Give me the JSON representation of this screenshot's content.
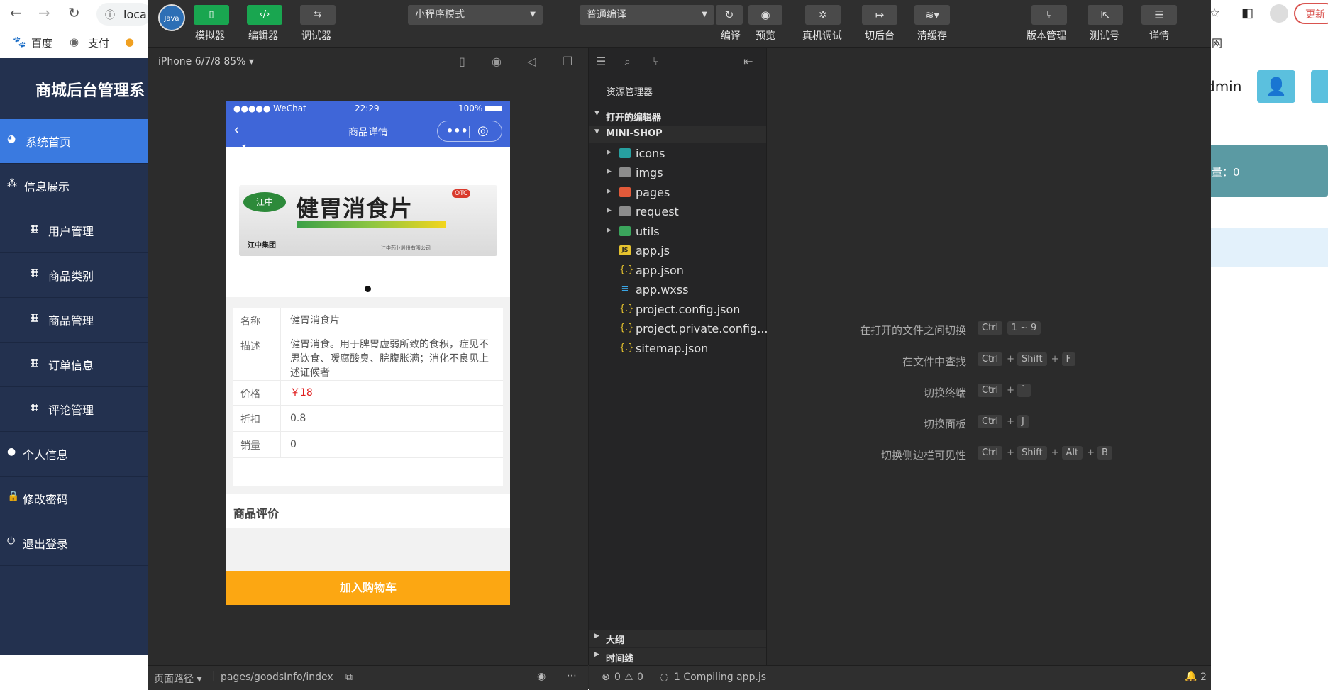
{
  "browser": {
    "address_partial": "loca",
    "bookmarks": [
      "百度",
      "支付"
    ],
    "bookmark_tail": "网",
    "update_label": "更新"
  },
  "admin": {
    "title": "商城后台管理系",
    "user_partial": "dmin",
    "menu": [
      {
        "label": "系统首页",
        "icon": "dashboard-icon",
        "active": true
      },
      {
        "label": "信息展示",
        "icon": "network-icon",
        "active": false
      },
      {
        "label": "用户管理",
        "icon": "grid-icon",
        "active": false
      },
      {
        "label": "商品类别",
        "icon": "grid-icon",
        "active": false
      },
      {
        "label": "商品管理",
        "icon": "grid-icon",
        "active": false
      },
      {
        "label": "订单信息",
        "icon": "grid-icon",
        "active": false
      },
      {
        "label": "评论管理",
        "icon": "grid-icon",
        "active": false
      },
      {
        "label": "个人信息",
        "icon": "user-icon",
        "active": false
      },
      {
        "label": "修改密码",
        "icon": "lock-icon",
        "active": false
      },
      {
        "label": "退出登录",
        "icon": "power-icon",
        "active": false
      }
    ],
    "stat_text": "量：0"
  },
  "devtools": {
    "logo_text": "Java",
    "toolbar": {
      "simulator": "模拟器",
      "editor": "编辑器",
      "debugger": "调试器",
      "mode_select": "小程序模式",
      "compile_select": "普通编译",
      "compile": "编译",
      "preview": "预览",
      "real_debug": "真机调试",
      "background": "切后台",
      "clear_cache": "清缓存",
      "version": "版本管理",
      "test_account": "测试号",
      "details": "详情"
    },
    "device_label": "iPhone 6/7/8 85% ▾",
    "phone": {
      "status_carrier": "●●●●● WeChat",
      "status_time": "22:29",
      "status_battery": "100%",
      "nav_title": "商品详情",
      "product_image": {
        "name_text": "健胃消食片",
        "brand_text": "江中",
        "otc_text": "OTC",
        "maker_text": "江中药业股份有限公司",
        "mark_text": "江中集团"
      },
      "info": [
        {
          "key": "名称",
          "value": "健胃消食片"
        },
        {
          "key": "描述",
          "value": "健胃消食。用于脾胃虚弱所致的食积，症见不思饮食、嗳腐酸臭、脘腹胀满；消化不良见上述证候者"
        },
        {
          "key": "价格",
          "value": "￥18"
        },
        {
          "key": "折扣",
          "value": "0.8"
        },
        {
          "key": "销量",
          "value": "0"
        }
      ],
      "review_title": "商品评价",
      "add_cart": "加入购物车"
    },
    "sim_bottom": {
      "path_label": "页面路径 ▾",
      "path_value": "pages/goodsInfo/index"
    },
    "explorer": {
      "title": "资源管理器",
      "open_editors": "打开的编辑器",
      "project": "MINI-SHOP",
      "items": [
        {
          "name": "icons",
          "type": "folder-teal"
        },
        {
          "name": "imgs",
          "type": "folder"
        },
        {
          "name": "pages",
          "type": "folder-orange"
        },
        {
          "name": "request",
          "type": "folder"
        },
        {
          "name": "utils",
          "type": "folder-green"
        },
        {
          "name": "app.js",
          "type": "js"
        },
        {
          "name": "app.json",
          "type": "json"
        },
        {
          "name": "app.wxss",
          "type": "css"
        },
        {
          "name": "project.config.json",
          "type": "json"
        },
        {
          "name": "project.private.config...",
          "type": "json"
        },
        {
          "name": "sitemap.json",
          "type": "json"
        }
      ],
      "outline": "大纲",
      "timeline": "时间线"
    },
    "shortcuts": [
      {
        "label": "在打开的文件之间切换",
        "keys": [
          "Ctrl",
          "1 ~ 9"
        ]
      },
      {
        "label": "在文件中查找",
        "keys": [
          "Ctrl",
          "+",
          "Shift",
          "+",
          "F"
        ]
      },
      {
        "label": "切换终端",
        "keys": [
          "Ctrl",
          "+",
          "`"
        ]
      },
      {
        "label": "切换面板",
        "keys": [
          "Ctrl",
          "+",
          "J"
        ]
      },
      {
        "label": "切换侧边栏可见性",
        "keys": [
          "Ctrl",
          "+",
          "Shift",
          "+",
          "Alt",
          "+",
          "B"
        ]
      }
    ],
    "status": {
      "errors": "0",
      "warnings": "0",
      "compiling": "1 Compiling app.js",
      "notifications": "2"
    }
  }
}
